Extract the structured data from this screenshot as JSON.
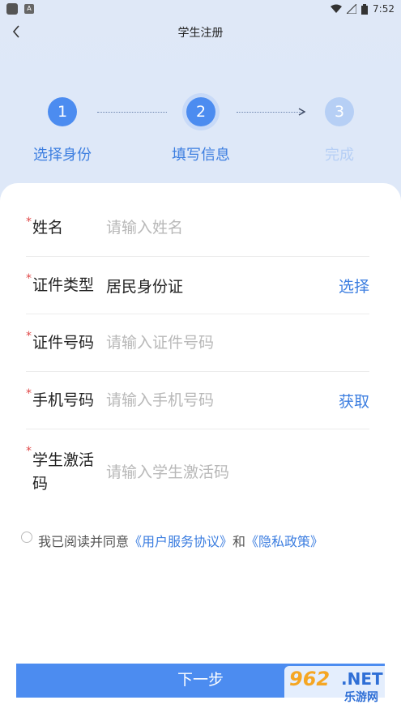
{
  "status": {
    "time": "7:52",
    "app_icon_letter": "A"
  },
  "nav": {
    "title": "学生注册"
  },
  "steps": [
    {
      "num": "1",
      "label": "选择身份"
    },
    {
      "num": "2",
      "label": "填写信息"
    },
    {
      "num": "3",
      "label": "完成"
    }
  ],
  "fields": {
    "name": {
      "label": "姓名",
      "placeholder": "请输入姓名"
    },
    "id_type": {
      "label": "证件类型",
      "value": "居民身份证",
      "action": "选择"
    },
    "id_number": {
      "label": "证件号码",
      "placeholder": "请输入证件号码"
    },
    "phone": {
      "label": "手机号码",
      "placeholder": "请输入手机号码",
      "action": "获取"
    },
    "activation": {
      "label_line1": "学生激活",
      "label_line2": "码",
      "placeholder": "请输入学生激活码"
    }
  },
  "required_mark": "*",
  "agreement": {
    "prefix": "我已阅读并同意",
    "terms": "《用户服务协议》",
    "and": "和",
    "privacy": "《隐私政策》"
  },
  "next_button": "下一步",
  "watermark": {
    "num": "962",
    "suffix": ".NET",
    "sub": "乐游网"
  },
  "colors": {
    "accent": "#4c8cf0",
    "required": "#e04848",
    "pending": "#b6cff5"
  }
}
